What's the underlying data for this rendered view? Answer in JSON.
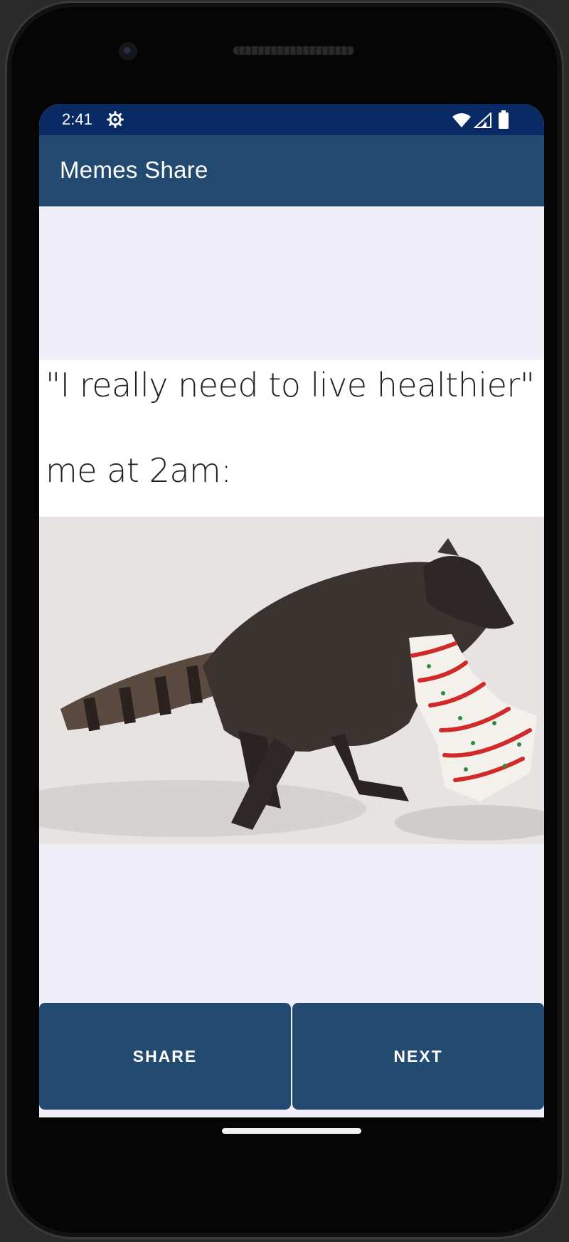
{
  "status_bar": {
    "time": "2:41",
    "icons": [
      "gear-icon",
      "wifi-icon",
      "signal-icon",
      "battery-icon"
    ],
    "background": "#0a2a66"
  },
  "app_bar": {
    "title": "Memes Share",
    "background": "#234a70"
  },
  "meme": {
    "caption_line1": "\"I really need to live healthier\"",
    "caption_line2": "me at 2am:"
  },
  "buttons": {
    "share_label": "SHARE",
    "next_label": "NEXT"
  },
  "colors": {
    "screen_background": "#f0eef9",
    "button_background": "#234a70"
  }
}
